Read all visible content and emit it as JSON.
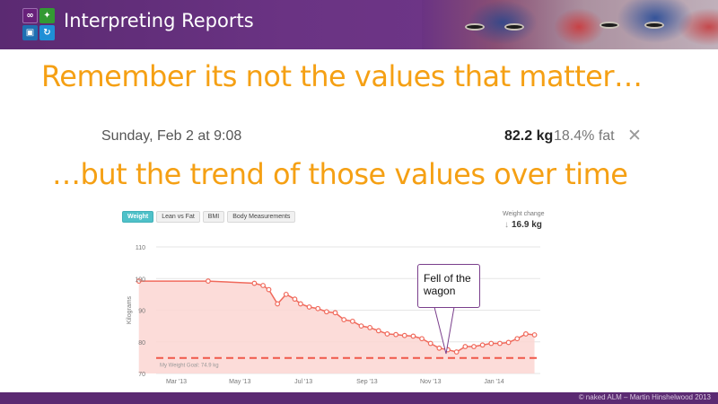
{
  "header": {
    "title": "Interpreting Reports",
    "logo_tiles": [
      "visual-studio-icon",
      "team-foundation-icon",
      "server-icon",
      "sync-icon"
    ]
  },
  "headline_1": "Remember its not the values that matter…",
  "entry": {
    "date": "Sunday, Feb 2 at 9:08",
    "weight": "82.2 kg",
    "fat": "18.4% fat",
    "close": "✕"
  },
  "headline_2": "…but the trend of those values over time",
  "widget": {
    "tabs": [
      "Weight",
      "Lean vs Fat",
      "BMI",
      "Body Measurements"
    ],
    "active_tab": "Weight",
    "weight_change_label": "Weight change",
    "weight_change_value": "16.9 kg",
    "weight_change_arrow": "↓"
  },
  "callout": {
    "text_line1": "Fell of the",
    "text_line2": "wagon"
  },
  "footer": "© naked ALM – Martin Hinshelwood 2013",
  "colors": {
    "header_purple": "#6a3383",
    "headline_orange": "#f5a014",
    "series_line": "#f06a5c",
    "area_fill": "#fbd6d2",
    "goal_line": "#f0584a",
    "active_tab": "#4fc1c9"
  },
  "chart_data": {
    "type": "area",
    "ylabel": "Kilograms",
    "ylim": [
      70,
      110
    ],
    "yticks": [
      70,
      80,
      90,
      100,
      110
    ],
    "xtick_labels": [
      "Mar '13",
      "May '13",
      "Jul '13",
      "Sep '13",
      "Nov '13",
      "Jan '14"
    ],
    "x_range_months": [
      0,
      13.3
    ],
    "goal": {
      "label": "My Weight Goal: 74.9 kg",
      "value": 74.9
    },
    "grid": true,
    "series": [
      {
        "x": [
          -0.6,
          1.8,
          3.4,
          3.7,
          3.9,
          4.2,
          4.5,
          4.8,
          5.0,
          5.3,
          5.6,
          5.9,
          6.2,
          6.5,
          6.8,
          7.1,
          7.4,
          7.7,
          8.0,
          8.3,
          8.6,
          8.9,
          9.2,
          9.5,
          9.8,
          10.1,
          10.4,
          10.7,
          11.0,
          11.3,
          11.6,
          11.9,
          12.2,
          12.5,
          12.8,
          13.1
        ],
        "y": [
          99.2,
          99.2,
          98.5,
          97.8,
          96.5,
          92.0,
          95.0,
          93.5,
          92.0,
          91.0,
          90.5,
          89.5,
          89.2,
          87.0,
          86.5,
          85.0,
          84.5,
          83.5,
          82.5,
          82.3,
          82.0,
          81.8,
          81.0,
          79.5,
          78.0,
          77.5,
          76.8,
          78.5,
          78.5,
          79.0,
          79.5,
          79.5,
          79.8,
          81.0,
          82.5,
          82.2
        ]
      }
    ]
  }
}
